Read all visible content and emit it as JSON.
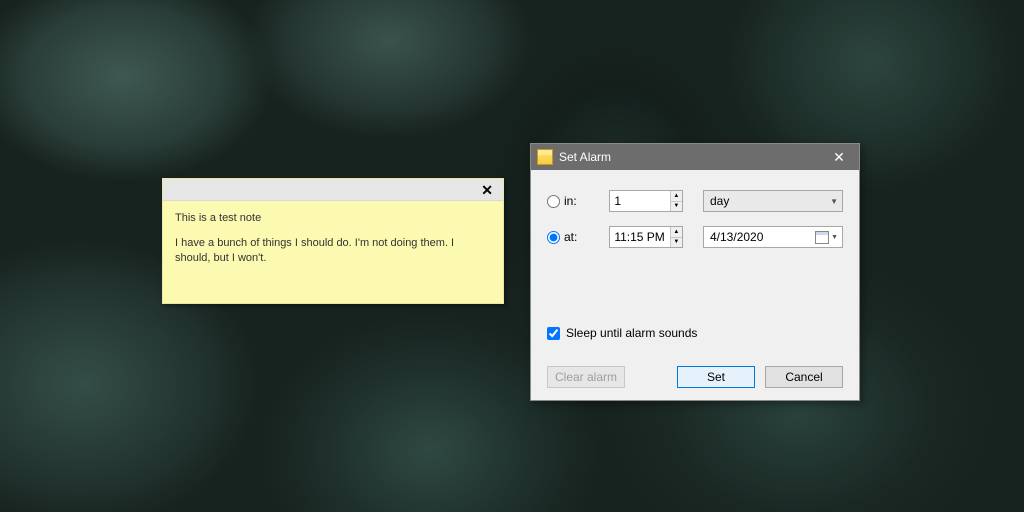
{
  "note": {
    "line1": "This is a test note",
    "line2": "I have a bunch of things I should do. I'm not doing them. I should, but I won't."
  },
  "dialog": {
    "title": "Set Alarm",
    "mode": {
      "in": {
        "label": "in:",
        "selected": false,
        "value": "1",
        "unit": "day"
      },
      "at": {
        "label": "at:",
        "selected": true,
        "time": "11:15 PM",
        "date": "4/13/2020"
      }
    },
    "sleep_checkbox": {
      "label": "Sleep until alarm sounds",
      "checked": true
    },
    "buttons": {
      "clear": "Clear alarm",
      "set": "Set",
      "cancel": "Cancel"
    }
  }
}
